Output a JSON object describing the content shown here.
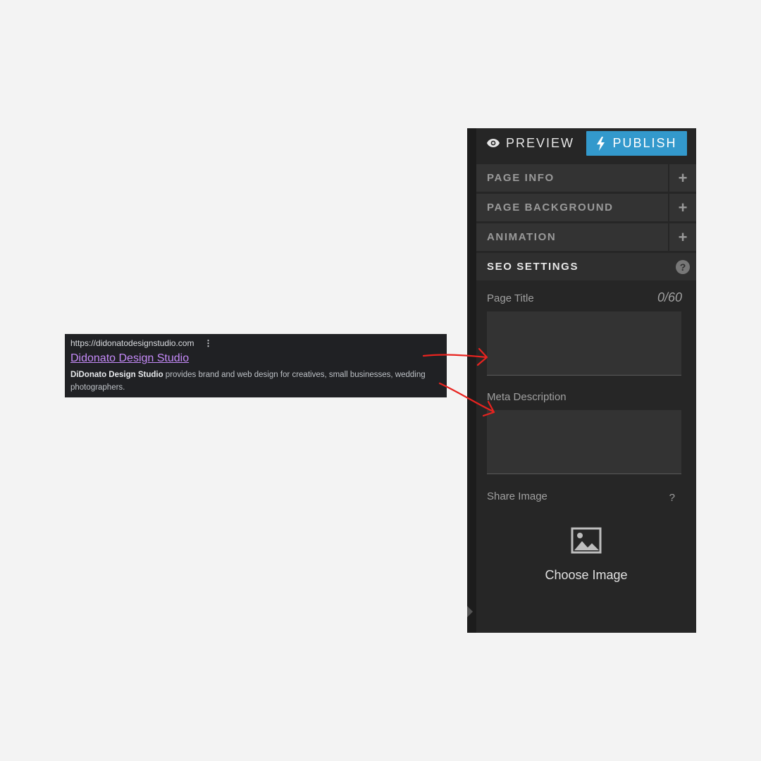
{
  "serp": {
    "url": "https://didonatodesignstudio.com",
    "menu_glyph": "⋮",
    "title": "Didonato Design Studio",
    "snippet_bold": "DiDonato Design Studio",
    "snippet_rest": " provides brand and web design for creatives, small businesses, wedding photographers."
  },
  "toolbar": {
    "preview_label": "PREVIEW",
    "publish_label": "PUBLISH",
    "preview_icon": "eye-icon",
    "publish_icon": "lightning-icon"
  },
  "accordion": [
    {
      "label": "PAGE INFO",
      "icon": "+"
    },
    {
      "label": "PAGE BACKGROUND",
      "icon": "+"
    },
    {
      "label": "ANIMATION",
      "icon": "+"
    },
    {
      "label": "SEO SETTINGS",
      "icon": "?"
    }
  ],
  "seo": {
    "page_title_label": "Page Title",
    "page_title_counter": "0/60",
    "page_title_value": "",
    "meta_description_label": "Meta Description",
    "meta_description_value": "",
    "share_image_label": "Share Image",
    "share_image_help": "?",
    "choose_image_label": "Choose Image"
  },
  "colors": {
    "publish": "#3399cc",
    "panel": "#262626",
    "link": "#c58af9",
    "arrow": "#e8231f"
  }
}
